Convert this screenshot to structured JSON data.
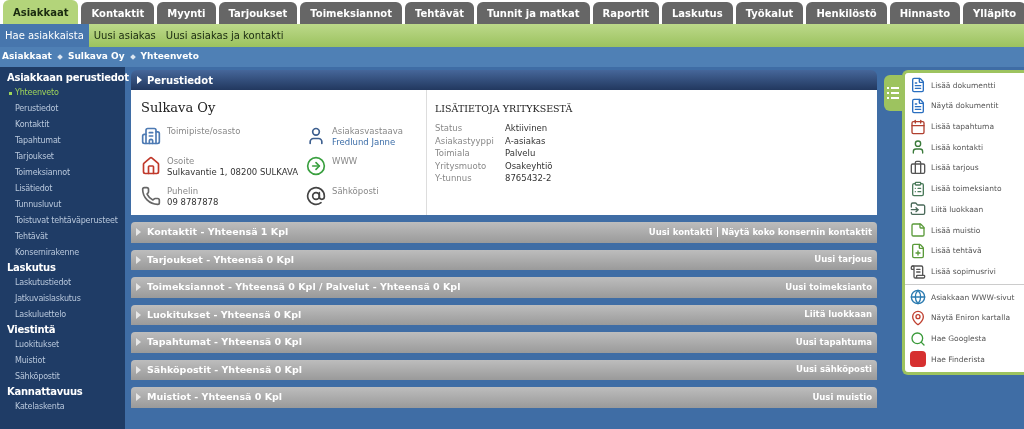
{
  "tabs": [
    {
      "label": "Asiakkaat",
      "selected": true
    },
    {
      "label": "Kontaktit",
      "selected": false
    },
    {
      "label": "Myynti",
      "selected": false
    },
    {
      "label": "Tarjoukset",
      "selected": false
    },
    {
      "label": "Toimeksiannot",
      "selected": false
    },
    {
      "label": "Tehtävät",
      "selected": false
    },
    {
      "label": "Tunnit ja matkat",
      "selected": false
    },
    {
      "label": "Raportit",
      "selected": false
    },
    {
      "label": "Laskutus",
      "selected": false
    },
    {
      "label": "Työkalut",
      "selected": false
    },
    {
      "label": "Henkilöstö",
      "selected": false
    },
    {
      "label": "Hinnasto",
      "selected": false
    },
    {
      "label": "Ylläpito",
      "selected": false
    }
  ],
  "subnav": [
    {
      "label": "Hae asiakkaista",
      "selected": true
    },
    {
      "label": "Uusi asiakas",
      "selected": false
    },
    {
      "label": "Uusi asiakas ja kontakti",
      "selected": false
    }
  ],
  "breadcrumb": [
    "Asiakkaat",
    "Sulkava Oy",
    "Yhteenveto"
  ],
  "sidebar": [
    {
      "heading": "Asiakkaan perustiedot",
      "items": [
        {
          "label": "Yhteenveto",
          "selected": true
        },
        {
          "label": "Perustiedot",
          "selected": false
        },
        {
          "label": "Kontaktit",
          "selected": false
        },
        {
          "label": "Tapahtumat",
          "selected": false
        },
        {
          "label": "Tarjoukset",
          "selected": false
        },
        {
          "label": "Toimeksiannot",
          "selected": false
        },
        {
          "label": "Lisätiedot",
          "selected": false
        },
        {
          "label": "Tunnusluvut",
          "selected": false
        },
        {
          "label": "Toistuvat tehtäväperusteet",
          "selected": false
        },
        {
          "label": "Tehtävät",
          "selected": false
        },
        {
          "label": "Konsernirakenne",
          "selected": false
        }
      ]
    },
    {
      "heading": "Laskutus",
      "items": [
        {
          "label": "Laskutustiedot",
          "selected": false
        },
        {
          "label": "Jatkuvaislaskutus",
          "selected": false
        },
        {
          "label": "Laskuluettelo",
          "selected": false
        }
      ]
    },
    {
      "heading": "Viestintä",
      "items": [
        {
          "label": "Luokitukset",
          "selected": false
        },
        {
          "label": "Muistiot",
          "selected": false
        },
        {
          "label": "Sähköpostit",
          "selected": false
        }
      ]
    },
    {
      "heading": "Kannattavuus",
      "items": [
        {
          "label": "Katelaskenta",
          "selected": false
        }
      ]
    }
  ],
  "perustiedot": {
    "title": "Perustiedot",
    "company": "Sulkava Oy",
    "fields": [
      {
        "kind": "office",
        "label": "Toimipiste/osasto"
      },
      {
        "kind": "person",
        "label": "Asiakasvastaava",
        "value": "Fredlund Janne"
      },
      {
        "kind": "home",
        "label": "Osoite",
        "value": "Sulkavantie 1, 08200 SULKAVA"
      },
      {
        "kind": "web",
        "label": "WWW"
      },
      {
        "kind": "phone",
        "label": "Puhelin",
        "value": "09 8787878"
      },
      {
        "kind": "email",
        "label": "Sähköposti"
      }
    ],
    "extra_title": "LISÄTIETOJA YRITYKSESTÄ",
    "extra": [
      {
        "label": "Status",
        "value": "Aktiivinen"
      },
      {
        "label": "Asiakastyyppi",
        "value": "A-asiakas"
      },
      {
        "label": "Toimiala",
        "value": "Palvelu"
      },
      {
        "label": "Yritysmuoto",
        "value": "Osakeyhtiö"
      },
      {
        "label": "Y-tunnus",
        "value": "8765432-2"
      }
    ]
  },
  "sections": [
    {
      "title": "Kontaktit - Yhteensä 1 Kpl",
      "actions": [
        "Uusi kontakti",
        "Näytä koko konsernin kontaktit"
      ]
    },
    {
      "title": "Tarjoukset - Yhteensä 0 Kpl",
      "actions": [
        "Uusi tarjous"
      ]
    },
    {
      "title": "Toimeksiannot - Yhteensä 0 Kpl / Palvelut - Yhteensä 0 Kpl",
      "actions": [
        "Uusi toimeksianto"
      ]
    },
    {
      "title": "Luokitukset - Yhteensä 0 Kpl",
      "actions": [
        "Liitä luokkaan"
      ]
    },
    {
      "title": "Tapahtumat - Yhteensä 0 Kpl",
      "actions": [
        "Uusi tapahtuma"
      ]
    },
    {
      "title": "Sähköpostit - Yhteensä 0 Kpl",
      "actions": [
        "Uusi sähköposti"
      ]
    },
    {
      "title": "Muistiot - Yhteensä 0 Kpl",
      "actions": [
        "Uusi muistio"
      ]
    }
  ],
  "quick_menu": [
    [
      {
        "kind": "document",
        "label": "Lisää dokumentti"
      },
      {
        "kind": "document",
        "label": "Näytä dokumentit"
      },
      {
        "kind": "event",
        "label": "Lisää tapahtuma"
      },
      {
        "kind": "contact",
        "label": "Lisää kontakti"
      },
      {
        "kind": "offer",
        "label": "Lisää tarjous"
      },
      {
        "kind": "assignment",
        "label": "Lisää toimeksianto"
      },
      {
        "kind": "class",
        "label": "Liitä luokkaan"
      },
      {
        "kind": "note",
        "label": "Lisää muistio"
      },
      {
        "kind": "task",
        "label": "Lisää tehtävä"
      },
      {
        "kind": "contract",
        "label": "Lisää sopimusrivi"
      }
    ],
    [
      {
        "kind": "globe",
        "label": "Asiakkaan WWW-sivut"
      },
      {
        "kind": "map",
        "label": "Näytä Eniron kartalla"
      },
      {
        "kind": "google",
        "label": "Hae Googlesta"
      },
      {
        "kind": "finder",
        "label": "Hae Finderista"
      }
    ]
  ]
}
